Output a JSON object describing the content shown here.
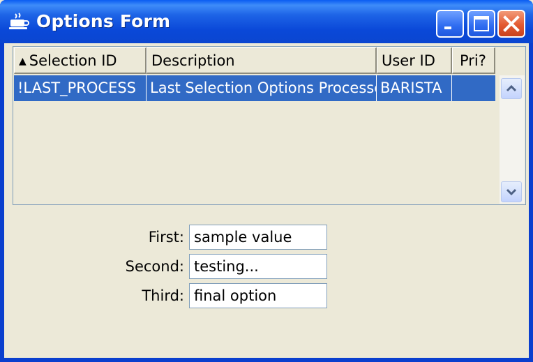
{
  "window": {
    "title": "Options Form",
    "app_icon": "coffee-cup-icon",
    "controls": {
      "minimize": "minimize-icon",
      "maximize": "maximize-icon",
      "close": "close-icon"
    }
  },
  "grid": {
    "columns": [
      {
        "label": "Selection ID",
        "sort": "ascending"
      },
      {
        "label": "Description"
      },
      {
        "label": "User ID"
      },
      {
        "label": "Pri?"
      }
    ],
    "rows": [
      {
        "selection_id": "!LAST_PROCESS",
        "description": "Last Selection Options Processed",
        "user_id": "BARISTA",
        "pri": "",
        "selected": true
      }
    ]
  },
  "form": {
    "first": {
      "label": "First:",
      "value": "sample value"
    },
    "second": {
      "label": "Second:",
      "value": "testing..."
    },
    "third": {
      "label": "Third:",
      "value": "final option"
    }
  },
  "colors": {
    "titlebar": "#0A48D8",
    "selection": "#316AC5",
    "window_face": "#ECE9D8",
    "close_button": "#E35A32"
  }
}
